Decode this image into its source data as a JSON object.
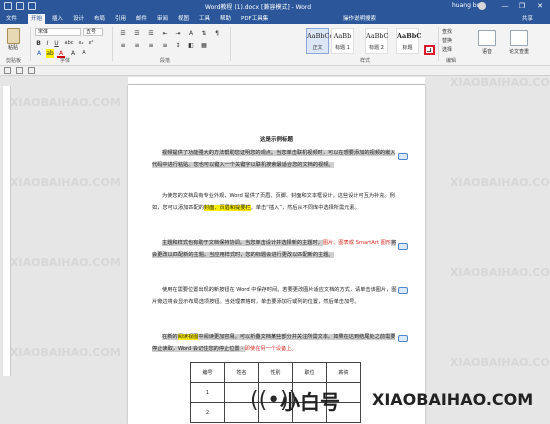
{
  "window": {
    "title": "Word教程 (1).docx [兼容模式] - Word",
    "user": "huang bo",
    "controls": [
      "—",
      "❐",
      "✕"
    ]
  },
  "tabs": [
    "文件",
    "开始",
    "插入",
    "设计",
    "布局",
    "引用",
    "邮件",
    "审阅",
    "视图",
    "工具",
    "帮助",
    "PDF工具集"
  ],
  "active_tab": "开始",
  "tell_me": "操作说明搜索",
  "share": "共享",
  "ribbon": {
    "paste_label": "粘贴",
    "clipboard_group": "剪贴板",
    "font_name": "宋体",
    "font_size": "五号",
    "font_group": "字体",
    "paragraph_group": "段落",
    "styles_group": "样式",
    "styles": [
      {
        "sample": "AaBbCcI",
        "name": "正文"
      },
      {
        "sample": "AaBb",
        "name": "标题 1"
      },
      {
        "sample": "AaBbC",
        "name": "标题 2"
      },
      {
        "sample": "AaBbC",
        "name": "标题"
      }
    ],
    "edit_items": [
      "查找",
      "替换",
      "选择"
    ],
    "edit_group": "编辑",
    "extra_buttons": [
      "语音",
      "论文查重"
    ]
  },
  "document": {
    "title": "这是示例标题",
    "table_header": [
      "编号",
      "姓名",
      "性别",
      "职位",
      "薪资"
    ],
    "table_rows": [
      "1",
      "2",
      "3"
    ]
  },
  "watermark": {
    "site": "XIAOBAIHAO.COM",
    "cn": "小白号"
  }
}
